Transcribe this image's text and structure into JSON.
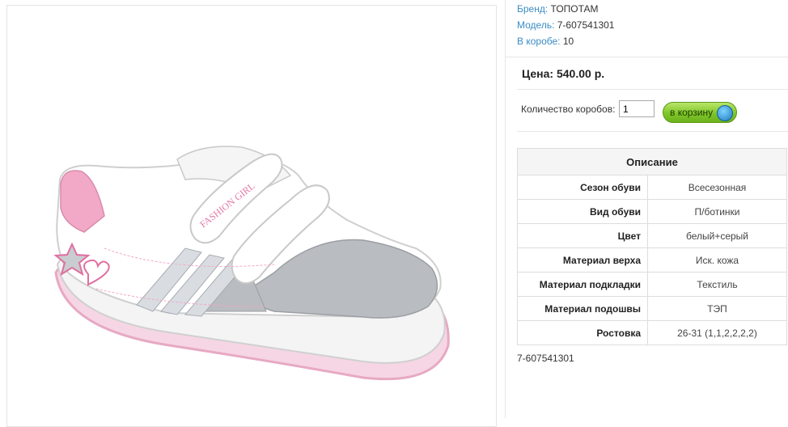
{
  "product": {
    "brand_label": "Бренд:",
    "brand": "ТОПОТАМ",
    "model_label": "Модель:",
    "model": "7-607541301",
    "box_label": "В коробе:",
    "box_count": "10"
  },
  "price": {
    "text": "Цена: 540.00 р."
  },
  "order": {
    "qty_label": "Количество коробов:",
    "qty_value": "1",
    "cart_label": "в корзину"
  },
  "specs": {
    "title": "Описание",
    "rows": [
      {
        "key": "Сезон обуви",
        "value": "Всесезонная"
      },
      {
        "key": "Вид обуви",
        "value": "П/ботинки"
      },
      {
        "key": "Цвет",
        "value": "белый+серый"
      },
      {
        "key": "Материал верха",
        "value": "Иск. кожа"
      },
      {
        "key": "Материал подкладки",
        "value": "Текстиль"
      },
      {
        "key": "Материал подошвы",
        "value": "ТЭП"
      },
      {
        "key": "Ростовка",
        "value": "26-31 (1,1,2,2,2,2)"
      }
    ]
  },
  "sku": "7-607541301",
  "image": {
    "strap_text": "FASHION GIRL"
  },
  "colors": {
    "link": "#3a8cc4",
    "pink": "#f2a9c8",
    "grey": "#b9bcc0",
    "button_green": "#7fc62a"
  }
}
